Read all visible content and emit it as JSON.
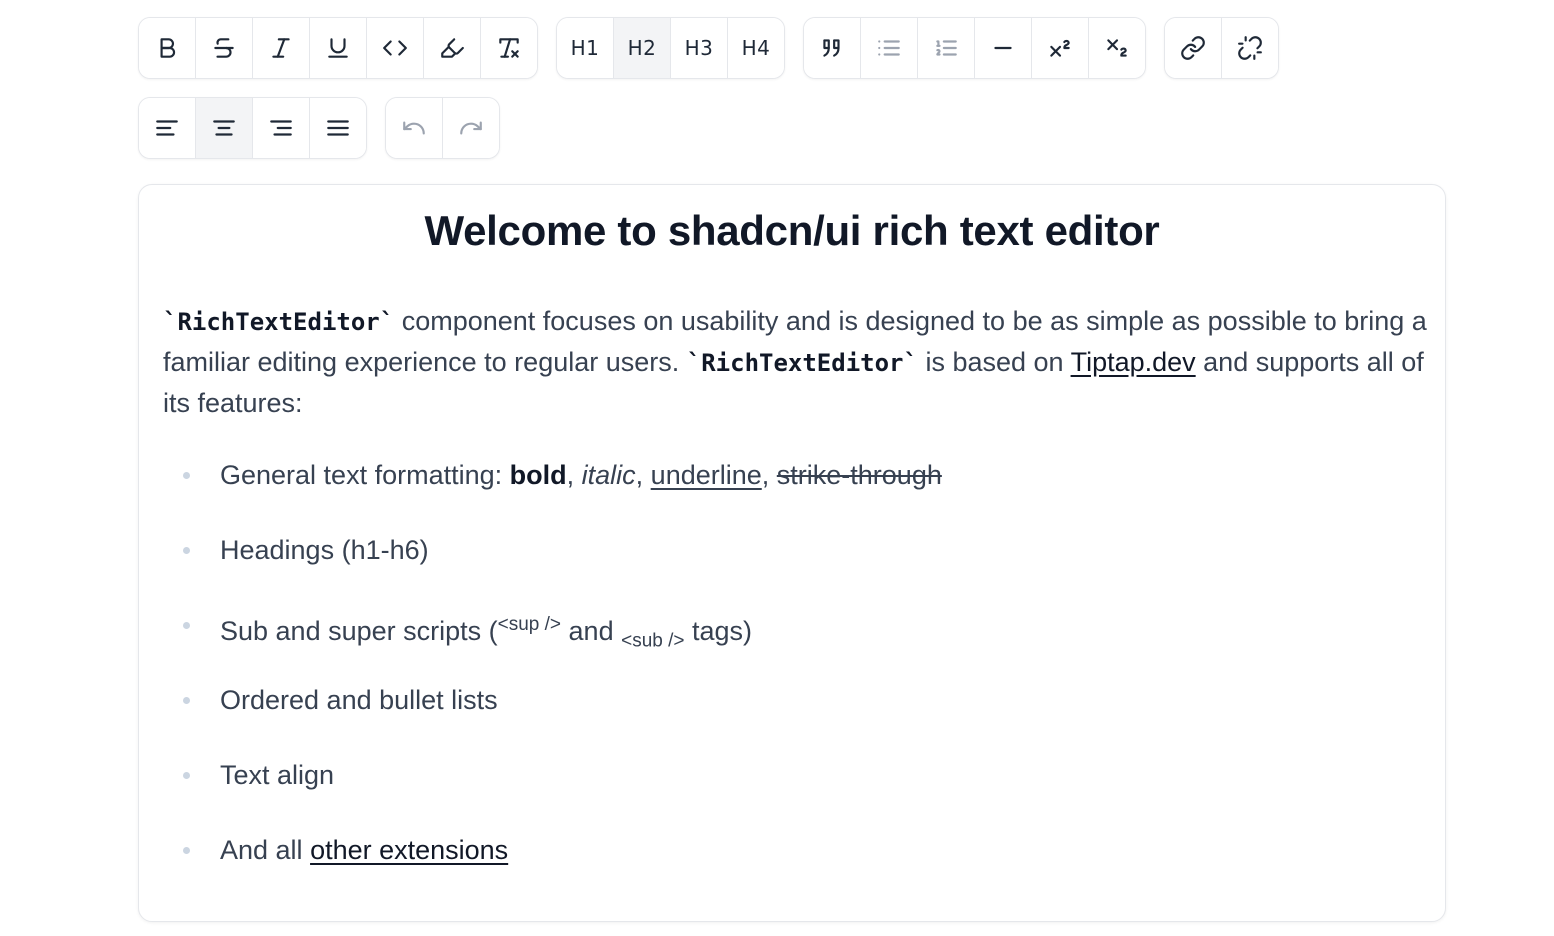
{
  "toolbar": {
    "format": [
      {
        "name": "bold-button",
        "icon": "bold-icon"
      },
      {
        "name": "strikethrough-button",
        "icon": "strikethrough-icon"
      },
      {
        "name": "italic-button",
        "icon": "italic-icon"
      },
      {
        "name": "underline-button",
        "icon": "underline-icon"
      },
      {
        "name": "code-button",
        "icon": "code-icon"
      },
      {
        "name": "highlight-button",
        "icon": "highlighter-icon"
      },
      {
        "name": "clear-format-button",
        "icon": "remove-formatting-icon"
      }
    ],
    "headings": {
      "h1": "H1",
      "h2": "H2",
      "h3": "H3",
      "h4": "H4",
      "active": "H2"
    },
    "blocks": [
      {
        "name": "blockquote-button",
        "icon": "quote-icon"
      },
      {
        "name": "bullet-list-button",
        "icon": "list-icon"
      },
      {
        "name": "ordered-list-button",
        "icon": "list-ordered-icon"
      },
      {
        "name": "horizontal-rule-button",
        "icon": "minus-icon"
      },
      {
        "name": "superscript-button",
        "icon": "superscript-icon"
      },
      {
        "name": "subscript-button",
        "icon": "subscript-icon"
      }
    ],
    "links": [
      {
        "name": "link-button",
        "icon": "link-icon"
      },
      {
        "name": "unlink-button",
        "icon": "unlink-icon"
      }
    ],
    "align": {
      "active": "center"
    },
    "history": [
      {
        "name": "undo-button",
        "icon": "undo-icon"
      },
      {
        "name": "redo-button",
        "icon": "redo-icon"
      }
    ]
  },
  "editor": {
    "title": "Welcome to shadcn/ui rich text editor",
    "intro": {
      "code1": "`RichTextEditor`",
      "text1": " component focuses on usability and is designed to be as simple as possible to bring a familiar editing experience to regular users. ",
      "code2": "`RichTextEditor`",
      "text2": " is based on ",
      "link": "Tiptap.dev",
      "text3": " and supports all of its features:"
    },
    "features": {
      "f1_prefix": "General text formatting: ",
      "f1_bold": "bold",
      "f1_sep1": ", ",
      "f1_italic": "italic",
      "f1_sep2": ", ",
      "f1_underline": "underline",
      "f1_sep3": ", ",
      "f1_strike": "strike-through",
      "f2": "Headings (h1-h6)",
      "f3_prefix": "Sub and super scripts (",
      "f3_sup": "<sup />",
      "f3_mid": " and ",
      "f3_sub": "<sub />",
      "f3_suffix": " tags)",
      "f4": "Ordered and bullet lists",
      "f5": "Text align",
      "f6_prefix": "And all ",
      "f6_link": "other extensions"
    }
  }
}
